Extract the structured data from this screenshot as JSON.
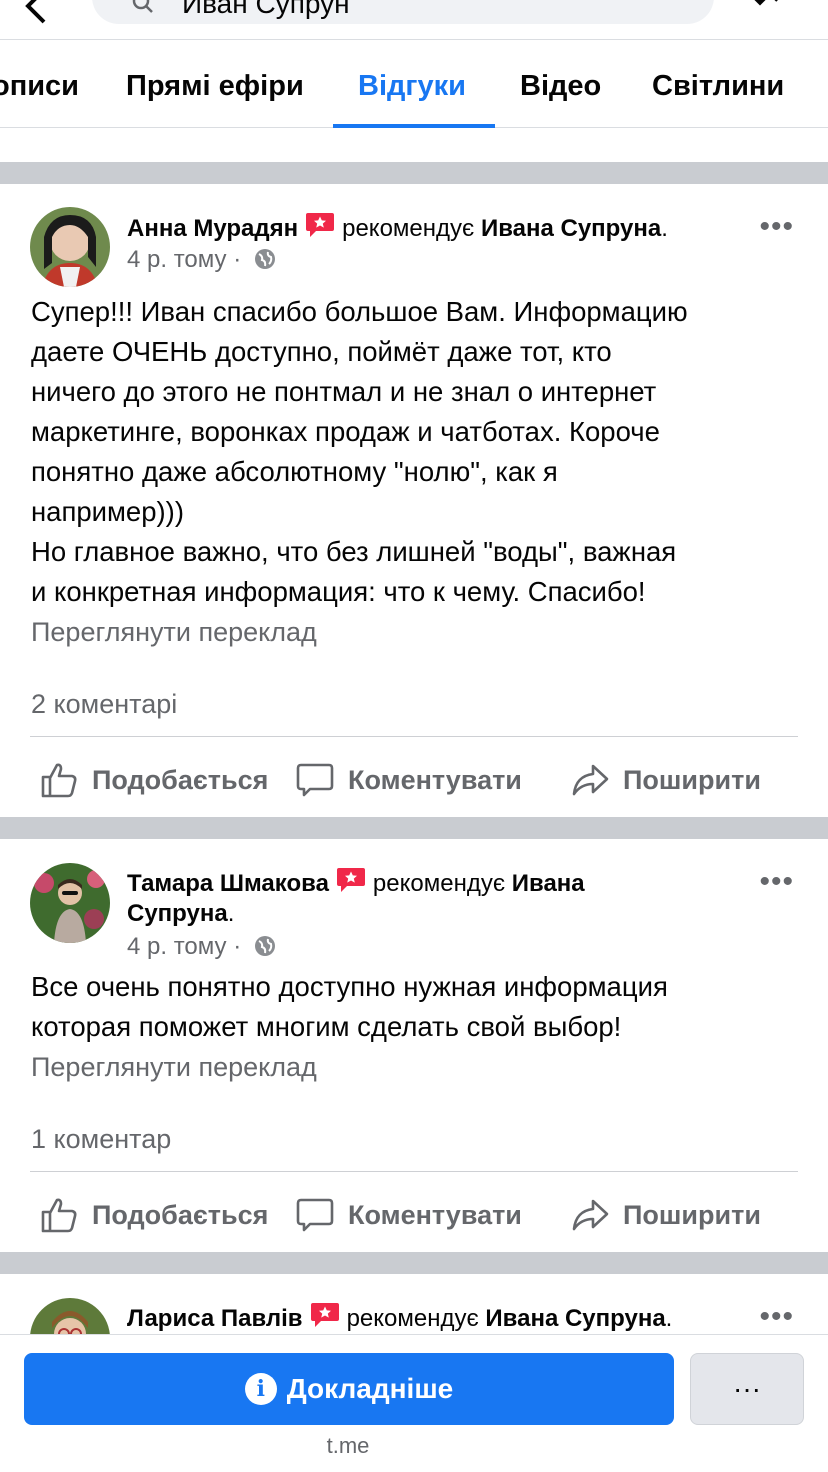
{
  "search": {
    "text": "Иван Супрун"
  },
  "tabs": [
    {
      "label": "описи"
    },
    {
      "label": "Прямі ефіри"
    },
    {
      "label": "Відгуки"
    },
    {
      "label": "Відео"
    },
    {
      "label": "Світлини"
    }
  ],
  "actions": {
    "like": "Подобається",
    "comment": "Коментувати",
    "share": "Поширити"
  },
  "posts": [
    {
      "author": "Анна Мурадян",
      "recommends": "рекомендує",
      "target": "Ивана Супруна",
      "time": "4 р. тому",
      "text_lines": [
        "Супер!!! Иван спасибо большое Вам. Информацию",
        "даете ОЧЕНЬ доступно, поймёт даже тот, кто",
        "ничего до этого не понтмал и не знал о интернет",
        "маркетинге, воронках продаж и чатботах. Короче",
        "понятно даже абсолютному \"нолю\", как я",
        "например)))",
        "Но главное важно, что без лишней \"воды\", важная",
        "и конкретная информация: что к чему. Спасибо!"
      ],
      "translate": "Переглянути переклад",
      "comments": "2 коментарі"
    },
    {
      "author": "Тамара Шмакова",
      "recommends": "рекомендує",
      "target": "Ивана",
      "target2": "Супруна",
      "time": "4 р. тому",
      "text_lines": [
        "Все очень понятно доступно нужная информация",
        "которая поможет многим сделать свой выбор!"
      ],
      "translate": "Переглянути переклад",
      "comments": "1 коментар"
    },
    {
      "author": "Лариса Павлів",
      "recommends": "рекомендує",
      "target": "Ивана Супруна"
    }
  ],
  "bottom": {
    "cta": "Докладніше",
    "more": "···",
    "domain": "t.me"
  },
  "colors": {
    "accent": "#1877f2",
    "muted": "#65676b",
    "separator": "#c9ccd1",
    "recommend_badge": "#f02849"
  }
}
